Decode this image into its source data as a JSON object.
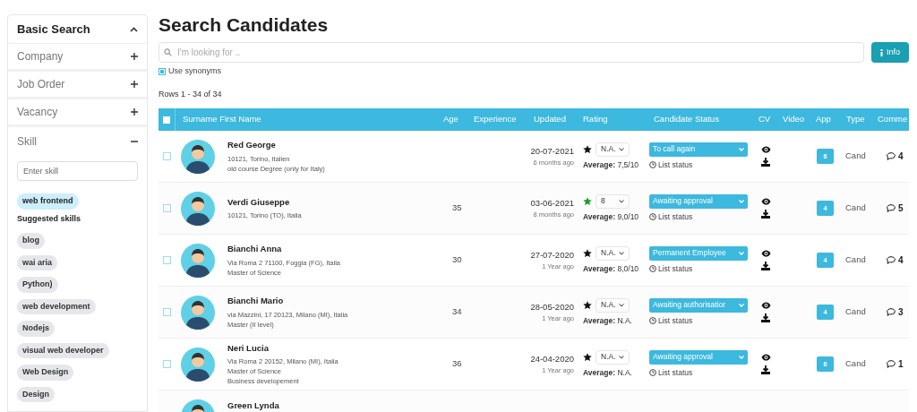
{
  "sidebar": {
    "title": "Basic Search",
    "expanded": true,
    "sections": [
      {
        "label": "Company",
        "expanded": false
      },
      {
        "label": "Job Order",
        "expanded": false
      },
      {
        "label": "Vacancy",
        "expanded": false
      },
      {
        "label": "Skill",
        "expanded": true
      }
    ],
    "skill_field": {
      "placeholder": "Enter skill"
    },
    "selected_skills": [
      "web frontend"
    ],
    "suggested_title": "Suggested skills",
    "suggested_skills": [
      "blog",
      "wai aria",
      "Python)",
      "web development",
      "Nodejs",
      "visual web developer",
      "Web Design",
      "Design"
    ]
  },
  "page_title": "Search Candidates",
  "search": {
    "placeholder": "I'm looking for .."
  },
  "info_button": "Info",
  "use_synonyms": {
    "label": "Use synonyms",
    "checked": true
  },
  "rows_info": "Rows 1 - 34 of 34",
  "table": {
    "select_all": {
      "checked": false
    },
    "columns": [
      "Surname First Name",
      "Age",
      "Experience",
      "Updated",
      "Rating",
      "Candidate Status",
      "CV",
      "Video",
      "App",
      "Type",
      "Comme"
    ],
    "rows": [
      {
        "name": "Red George",
        "details": [
          "10121, Torino, Italien",
          "old course Degree (only for Italy)"
        ],
        "age": "",
        "date": "20-07-2021",
        "ago": "6 months ago",
        "rated": false,
        "rating": "N.A.",
        "average_label": "Average:",
        "average": "7,5/10",
        "status": "To call again",
        "list_status": "List status",
        "app": "6",
        "type": "Cand",
        "comments": "4",
        "checked": false
      },
      {
        "name": "Verdi Giuseppe",
        "details": [
          "10121, Torino (TO), Italia"
        ],
        "age": "35",
        "date": "03-06-2021",
        "ago": "8 months ago",
        "rated": true,
        "rating": "8",
        "average_label": "Average:",
        "average": "9,0/10",
        "status": "Awaiting approval",
        "list_status": "List status",
        "app": "4",
        "type": "Cand",
        "comments": "5",
        "checked": false
      },
      {
        "name": "Bianchi Anna",
        "details": [
          "Via Roma 2 71100, Foggia (FG), Italia",
          "Master of Science"
        ],
        "age": "30",
        "date": "27-07-2020",
        "ago": "1 Year ago",
        "rated": false,
        "rating": "N.A.",
        "average_label": "Average:",
        "average": "8,0/10",
        "status": "Permanent Employee",
        "list_status": "List status",
        "app": "4",
        "type": "Cand",
        "comments": "4",
        "checked": false
      },
      {
        "name": "Bianchi Mario",
        "details": [
          "via Mazzini, 17 20123, Milano (MI), Italia",
          "Master (II level)"
        ],
        "age": "34",
        "date": "28-05-2020",
        "ago": "1 Year ago",
        "rated": false,
        "rating": "N.A.",
        "average_label": "Average:",
        "average": "N.A.",
        "status": "Awaiting authorisatior",
        "list_status": "List status",
        "app": "4",
        "type": "Cand",
        "comments": "3",
        "checked": false
      },
      {
        "name": "Neri Lucia",
        "details": [
          "Via Roma 2 20152, Milano (MI), Italia",
          "Master of Science",
          "Business developement"
        ],
        "age": "36",
        "date": "24-04-2020",
        "ago": "1 Year ago",
        "rated": false,
        "rating": "N.A.",
        "average_label": "Average:",
        "average": "N.A.",
        "status": "Awaiting approval",
        "list_status": "List status",
        "app": "6",
        "type": "Cand",
        "comments": "1",
        "checked": false
      },
      {
        "name": "Green Lynda",
        "partial": true
      }
    ]
  }
}
